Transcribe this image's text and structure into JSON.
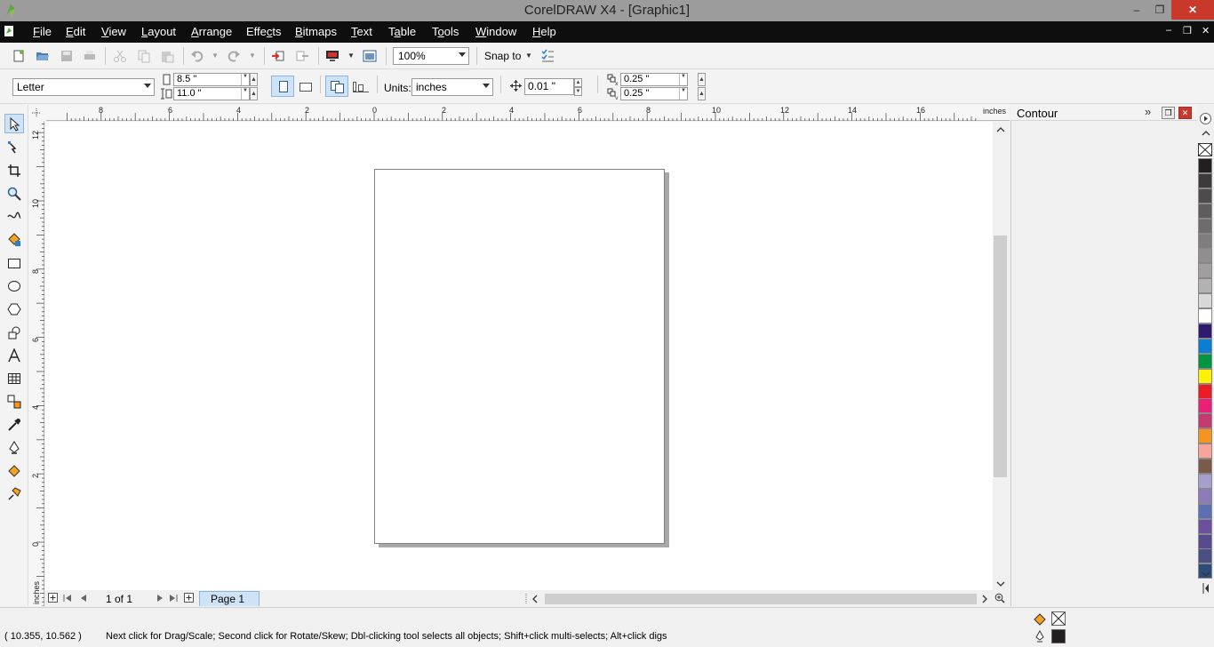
{
  "window": {
    "title": "CorelDRAW X4 - [Graphic1]",
    "minimize": "–",
    "maximize": "❐",
    "close": "✕"
  },
  "menu": {
    "items": [
      {
        "acc": "F",
        "rest": "ile"
      },
      {
        "acc": "E",
        "rest": "dit"
      },
      {
        "acc": "V",
        "rest": "iew"
      },
      {
        "acc": "L",
        "rest": "ayout"
      },
      {
        "acc": "A",
        "rest": "rrange"
      },
      {
        "pre": "Effe",
        "acc": "c",
        "rest": "ts"
      },
      {
        "acc": "B",
        "rest": "itmaps"
      },
      {
        "acc": "T",
        "rest": "ext"
      },
      {
        "pre": "T",
        "acc": "a",
        "rest": "ble"
      },
      {
        "pre": "T",
        "acc": "o",
        "rest": "ols"
      },
      {
        "acc": "W",
        "rest": "indow"
      },
      {
        "acc": "H",
        "rest": "elp"
      }
    ],
    "doc_controls": {
      "minimize": "–",
      "restore": "❐",
      "close": "✕"
    }
  },
  "standard_toolbar": {
    "zoom_level": "100%",
    "snap_to": "Snap to"
  },
  "property_bar": {
    "paper_size": "Letter",
    "width": "8.5 \"",
    "height": "11.0 \"",
    "units_label": "Units:",
    "units": "inches",
    "nudge": "0.01 \"",
    "dup_x": "0.25 \"",
    "dup_y": "0.25 \""
  },
  "rulers": {
    "horizontal_labels": [
      "8",
      "6",
      "4",
      "2",
      "0",
      "2",
      "4",
      "6",
      "8",
      "10",
      "12",
      "14",
      "16"
    ],
    "vertical_labels": [
      "12",
      "10",
      "8",
      "6",
      "4",
      "2",
      "0"
    ],
    "unit": "inches"
  },
  "navigator": {
    "page_count": "1 of 1",
    "page_tab": "Page 1"
  },
  "docker": {
    "title": "Contour"
  },
  "palette": {
    "colors": [
      "#231f20",
      "#3d3a3b",
      "#4d4b4c",
      "#5e5c5d",
      "#6e6c6d",
      "#7f7d7e",
      "#908e8f",
      "#a09e9f",
      "#b3b1b2",
      "#d8d8d8",
      "#ffffff",
      "#2e1a6e",
      "#0a7dd4",
      "#00963f",
      "#fff200",
      "#ed1c24",
      "#ec1f78",
      "#c4396e",
      "#f7941d",
      "#f7a49b",
      "#7a5a48",
      "#a59fce",
      "#8c7bb8",
      "#5b6fb4",
      "#6d4fa0",
      "#584a8e",
      "#4a4f84",
      "#2b4d7a"
    ]
  },
  "statusbar": {
    "coordinates": "( 10.355, 10.562 )",
    "hint": "Next click for Drag/Scale; Second click for Rotate/Skew; Dbl-clicking tool selects all objects; Shift+click multi-selects; Alt+click digs",
    "outline_color": "#231f20"
  }
}
